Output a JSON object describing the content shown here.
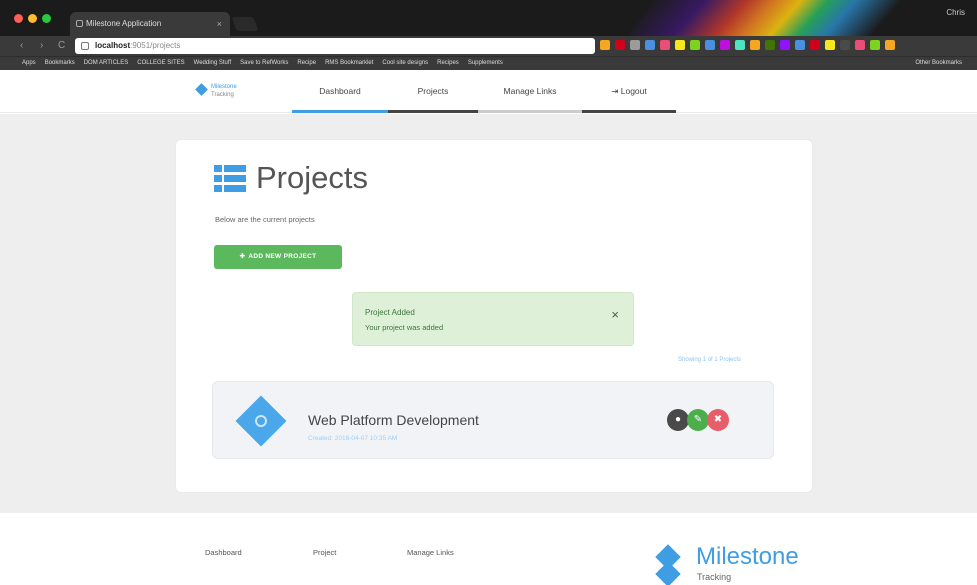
{
  "browser": {
    "tab_title": "Milestone Application",
    "tab_close": "×",
    "user": "Chris",
    "nav_back": "‹",
    "nav_forward": "›",
    "nav_reload": "C",
    "url_host": "localhost",
    "url_path": ":9051/projects",
    "bookmarks": [
      "Apps",
      "Bookmarks",
      "DOM ARTICLES",
      "COLLEGE SITES",
      "Wedding Stuff",
      "Save to RefWorks",
      "Recipe",
      "RMS Bookmarklet",
      "Cool site designs",
      "Recipes",
      "Supplements"
    ],
    "other_bookmarks": "Other Bookmarks",
    "ext_colors": [
      "#f5a623",
      "#d0021b",
      "#9b9b9b",
      "#4a90e2",
      "#e94e77",
      "#f8e71c",
      "#7ed321",
      "#4a90e2",
      "#bd10e0",
      "#50e3c2",
      "#f5a623",
      "#417505",
      "#9013fe",
      "#4a90e2",
      "#d0021b",
      "#f8e71c",
      "#4a4a4a",
      "#e94e77",
      "#7ed321",
      "#f5a623"
    ]
  },
  "nav": {
    "logo_name": "Milestone",
    "logo_sub": "Tracking",
    "links": [
      "Dashboard",
      "Projects",
      "Manage Links",
      "Logout"
    ]
  },
  "main": {
    "title": "Projects",
    "subtitle": "Below are the current projects",
    "add_button": "ADD NEW PROJECT",
    "alert_title": "Project Added",
    "alert_body": "Your project was added",
    "alert_close": "×",
    "showing": "Showing 1 of 1 Projects",
    "projects": [
      {
        "name": "Web Platform Development",
        "created": "Created: 2018-04-07 10:35 AM"
      }
    ]
  },
  "footer": {
    "links": [
      "Dashboard",
      "Project",
      "Manage Links"
    ],
    "logo_name": "Milestone",
    "logo_sub": "Tracking"
  },
  "colors": {
    "accent": "#3f9de3",
    "success": "#5cb85c",
    "danger": "#e85d6a",
    "alert_bg": "#dff0d8"
  },
  "icons": [
    "list-icon",
    "plus-icon",
    "close-icon",
    "view-icon",
    "edit-icon",
    "delete-icon",
    "logout-icon",
    "diamond-logo-icon"
  ]
}
